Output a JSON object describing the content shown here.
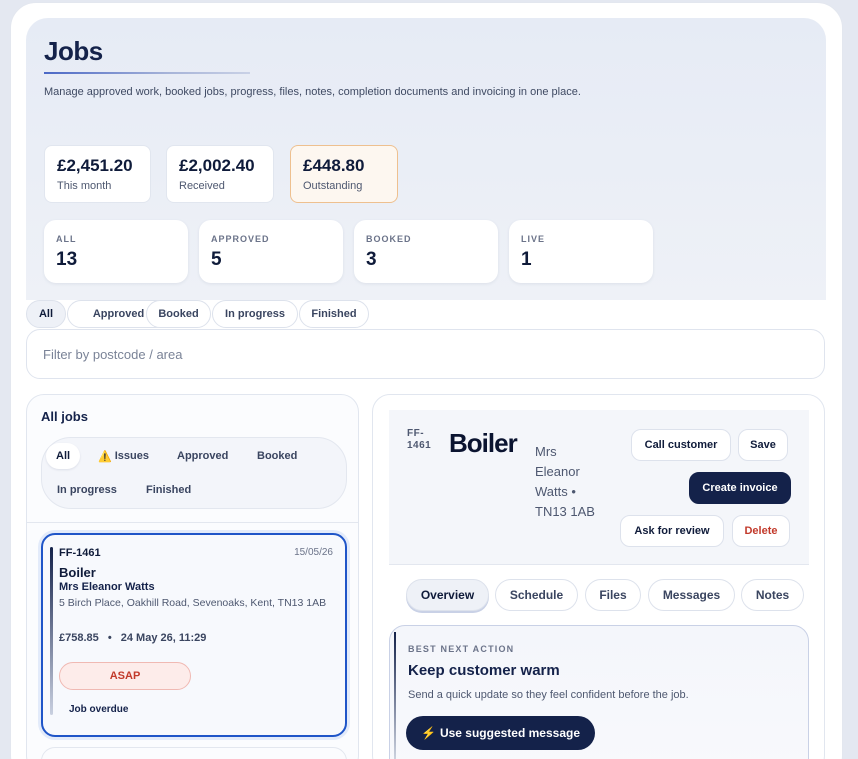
{
  "header": {
    "title": "Jobs",
    "subtitle": "Manage approved work, booked jobs, progress, files, notes, completion documents and invoicing in one place."
  },
  "money": [
    {
      "value": "£2,451.20",
      "label": "This month"
    },
    {
      "value": "£2,002.40",
      "label": "Received"
    },
    {
      "value": "£448.80",
      "label": "Outstanding"
    }
  ],
  "stats": [
    {
      "label": "ALL",
      "value": "13"
    },
    {
      "label": "APPROVED",
      "value": "5"
    },
    {
      "label": "BOOKED",
      "value": "3"
    },
    {
      "label": "LIVE",
      "value": "1"
    }
  ],
  "status_chips": [
    "All",
    "Approved",
    "Booked",
    "In progress",
    "Finished"
  ],
  "filter": {
    "placeholder": "Filter by postcode / area"
  },
  "jobs_list": {
    "title": "All jobs",
    "chips": [
      "All",
      "Issues",
      "Approved",
      "Booked",
      "In progress",
      "Finished"
    ],
    "issues_icon": "warning-icon"
  },
  "job_card": {
    "id": "FF-1461",
    "date": "15/05/26",
    "title": "Boiler",
    "customer": "Mrs Eleanor Watts",
    "address": "5 Birch Place, Oakhill Road, Sevenoaks, Kent, TN13 1AB",
    "price": "£758.85",
    "separator": "•",
    "datetime": "24 May 26, 11:29",
    "priority": "ASAP",
    "status": "Job overdue"
  },
  "detail": {
    "id": "FF-1461",
    "title": "Boiler",
    "customer": "Mrs Eleanor Watts • TN13 1AB",
    "buttons": {
      "call": "Call customer",
      "save": "Save",
      "invoice": "Create invoice",
      "review": "Ask for review",
      "delete": "Delete"
    },
    "tabs": [
      "Overview",
      "Schedule",
      "Files",
      "Messages",
      "Notes"
    ]
  },
  "next_action": {
    "label": "BEST NEXT ACTION",
    "title": "Keep customer warm",
    "subtitle": "Send a quick update so they feel confident before the job.",
    "button": "Use suggested message",
    "button_icon": "lightning-icon"
  },
  "colors": {
    "navy": "#14224a",
    "accent_blue": "#1f55c8",
    "danger": "#c23a2b",
    "warning_border": "#eec08f"
  }
}
